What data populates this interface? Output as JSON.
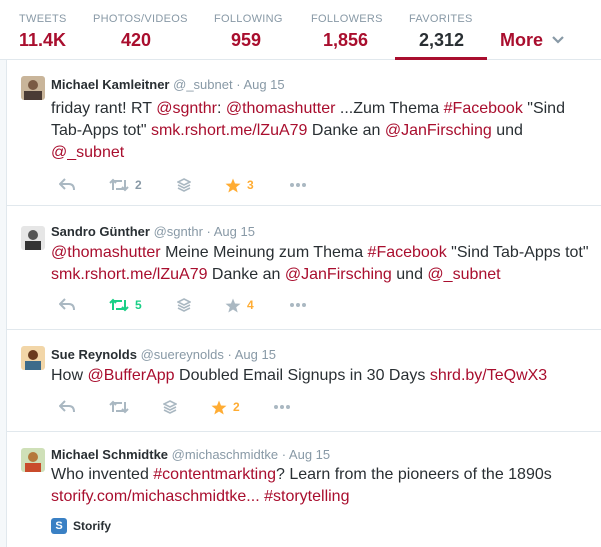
{
  "stats": [
    {
      "label": "TWEETS",
      "value": "11.4K"
    },
    {
      "label": "PHOTOS/VIDEOS",
      "value": "420"
    },
    {
      "label": "FOLLOWING",
      "value": "959"
    },
    {
      "label": "FOLLOWERS",
      "value": "1,856"
    },
    {
      "label": "FAVORITES",
      "value": "2,312"
    }
  ],
  "more_label": "More",
  "colors": {
    "accent": "#a90e2e",
    "retweet_active": "#19cf86",
    "favorite_active": "#ffac33",
    "muted": "#8899a6"
  },
  "tweets": [
    {
      "name": "Michael Kamleitner",
      "handle": "@_subnet",
      "time": "· Aug 15",
      "text_parts": [
        "friday rant! RT ",
        "@sgnthr",
        ": ",
        "@thomashutter",
        " ...Zum Thema ",
        "#Facebook",
        " \"Sind Tab-Apps tot\" ",
        "smk.rshort.me/lZuA79",
        " Danke an ",
        "@JanFirsching",
        " und ",
        "@_subnet"
      ],
      "retweets": "2",
      "favorites": "3",
      "retweeted": false,
      "favorited": true
    },
    {
      "name": "Sandro Günther",
      "handle": "@sgnthr",
      "time": "· Aug 15",
      "text_parts": [
        "@thomashutter",
        " Meine Meinung zum Thema ",
        "#Facebook",
        " \"Sind Tab-Apps tot\" ",
        "smk.rshort.me/lZuA79",
        " Danke an ",
        "@JanFirsching",
        " und ",
        "@_subnet"
      ],
      "retweets": "5",
      "favorites": "4",
      "retweeted": true,
      "favorited": false
    },
    {
      "name": "Sue Reynolds",
      "handle": "@suereynolds",
      "time": "· Aug 15",
      "text_parts": [
        "How ",
        "@BufferApp",
        " Doubled Email Signups in 30 Days ",
        "shrd.by/TeQwX3"
      ],
      "retweets": "",
      "favorites": "2",
      "retweeted": false,
      "favorited": true
    },
    {
      "name": "Michael Schmidtke",
      "handle": "@michaschmidtke",
      "time": "· Aug 15",
      "text_parts": [
        "Who invented ",
        "#contentmarkting",
        "? Learn from the pioneers of the 1890s ",
        "storify.com/michaschmidtke...",
        " ",
        "#storytelling"
      ],
      "card_label": "Storify"
    }
  ]
}
